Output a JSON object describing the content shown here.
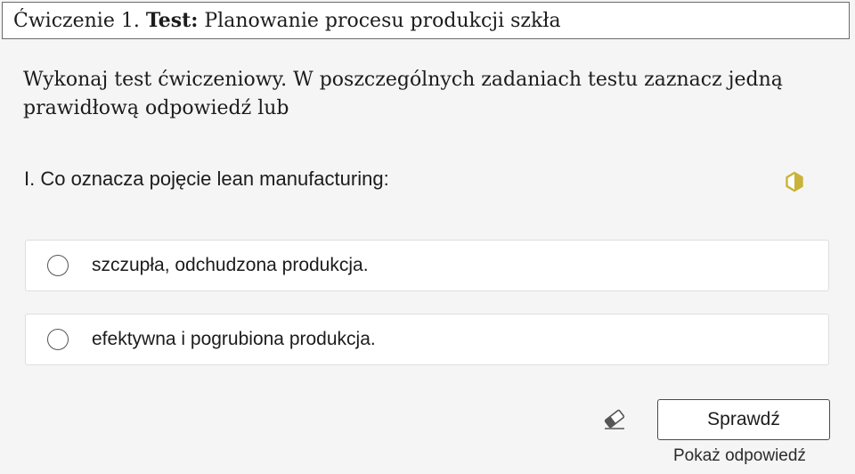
{
  "header": {
    "exercise_label": "Ćwiczenie 1.",
    "type_label": "Test:",
    "title": "Planowanie procesu produkcji szkła"
  },
  "instructions": "Wykonaj test ćwiczeniowy. W poszczególnych zadaniach testu zaznacz jedną prawidłową odpowiedź lub",
  "question": {
    "text": "I. Co oznacza pojęcie lean manufacturing:",
    "difficulty_icon": "hexagon-half-filled-icon",
    "difficulty_color": "#c9b33a"
  },
  "options": [
    {
      "label": "szczupła, odchudzona produkcja.",
      "selected": false
    },
    {
      "label": "efektywna i pogrubiona produkcja.",
      "selected": false
    }
  ],
  "actions": {
    "eraser_icon": "eraser-icon",
    "check_label": "Sprawdź",
    "show_answer_label": "Pokaż odpowiedź"
  }
}
